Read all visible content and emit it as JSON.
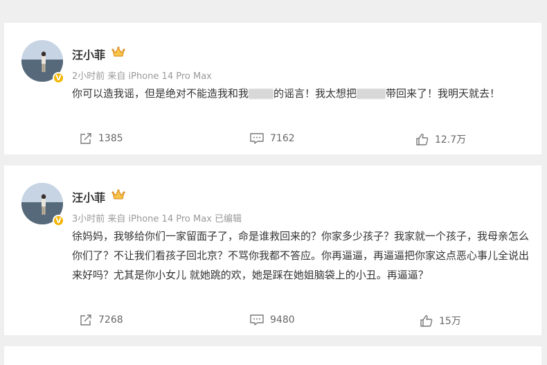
{
  "posts": [
    {
      "user": {
        "name": "汪小菲",
        "verified_badge": "V",
        "badge_color": "#f4b400"
      },
      "meta": "2小时前 来自 iPhone 14 Pro Max",
      "content": {
        "part1": "你可以造我谣，但是绝对不能造我和我",
        "part2": "的谣言！我太想把",
        "part3": "带回来了！我明天就去！"
      },
      "actions": {
        "repost": "1385",
        "comment": "7162",
        "like": "12.7万"
      }
    },
    {
      "user": {
        "name": "汪小菲",
        "verified_badge": "V",
        "badge_color": "#f4b400"
      },
      "meta": "3小时前 来自 iPhone 14 Pro Max 已编辑",
      "content": {
        "text": "徐妈妈，我够给你们一家留面子了，命是谁救回来的？你家多少孩子？我家就一个孩子，我母亲怎么你们了？不让我们看孩子回北京？不骂你我都不答应。你再逼逼，再逼逼把你家这点恶心事儿全说出来好吗？尤其是你小女儿 就她跳的欢，她是踩在她姐脑袋上的小丑。再逼逼？"
      },
      "actions": {
        "repost": "7268",
        "comment": "9480",
        "like": "15万"
      }
    }
  ],
  "icons": {
    "repost": "share-icon",
    "comment": "comment-icon",
    "like": "thumbs-up-icon",
    "crown": "crown-icon"
  }
}
